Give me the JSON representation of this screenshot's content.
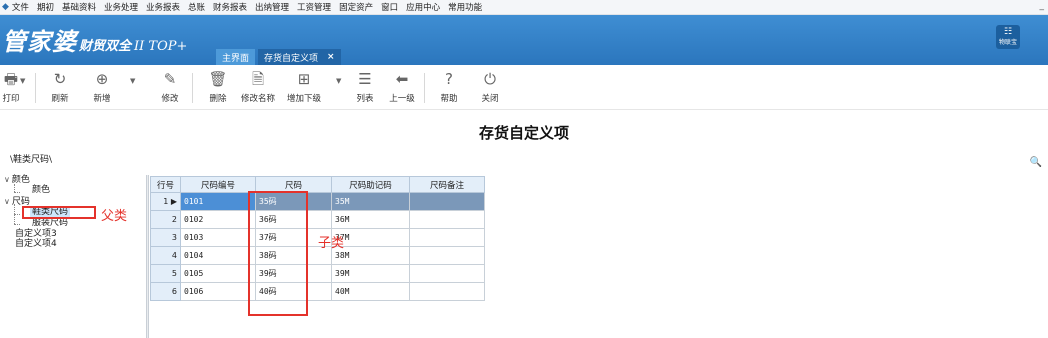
{
  "menu": {
    "items": [
      "文件",
      "期初",
      "基础资料",
      "业务处理",
      "业务报表",
      "总账",
      "财务报表",
      "出纳管理",
      "工资管理",
      "固定资产",
      "窗口",
      "应用中心",
      "常用功能"
    ],
    "window_button": "_"
  },
  "header": {
    "brand_main": "管家婆",
    "brand_sub": "财贸双全",
    "brand_version": "II TOP+",
    "tabs": [
      {
        "label": "主界面"
      },
      {
        "label": "存货自定义项",
        "close": "×"
      }
    ],
    "iot_label": "物联宝"
  },
  "toolbar": [
    {
      "label": "打印",
      "icon": "printer-icon"
    },
    {
      "label": "刷新",
      "icon": "refresh-icon"
    },
    {
      "label": "新增",
      "icon": "add-icon"
    },
    {
      "label": "修改",
      "icon": "edit-icon"
    },
    {
      "label": "删除",
      "icon": "trash-icon"
    },
    {
      "label": "修改名称",
      "icon": "rename-icon"
    },
    {
      "label": "增加下级",
      "icon": "add-child-icon"
    },
    {
      "label": "列表",
      "icon": "list-icon"
    },
    {
      "label": "上一级",
      "icon": "back-arrow-icon"
    },
    {
      "label": "帮助",
      "icon": "help-icon"
    },
    {
      "label": "关闭",
      "icon": "power-icon"
    }
  ],
  "page": {
    "title": "存货自定义项",
    "path": "\\鞋类尺码\\"
  },
  "tree": [
    {
      "label": "颜色",
      "expanded": true
    },
    {
      "label": "颜色"
    },
    {
      "label": "尺码",
      "expanded": true
    },
    {
      "label": "鞋类尺码",
      "selected": true
    },
    {
      "label": "服装尺码"
    },
    {
      "label": "自定义项3"
    },
    {
      "label": "自定义项4"
    }
  ],
  "grid": {
    "headers": [
      "行号",
      "尺码编号",
      "尺码",
      "尺码助记码",
      "尺码备注"
    ],
    "rows": [
      {
        "num": "1",
        "code": "0101",
        "size": "35码",
        "mnemonic": "35M",
        "note": ""
      },
      {
        "num": "2",
        "code": "0102",
        "size": "36码",
        "mnemonic": "36M",
        "note": ""
      },
      {
        "num": "3",
        "code": "0103",
        "size": "37码",
        "mnemonic": "37M",
        "note": ""
      },
      {
        "num": "4",
        "code": "0104",
        "size": "38码",
        "mnemonic": "38M",
        "note": ""
      },
      {
        "num": "5",
        "code": "0105",
        "size": "39码",
        "mnemonic": "39M",
        "note": ""
      },
      {
        "num": "6",
        "code": "0106",
        "size": "40码",
        "mnemonic": "40M",
        "note": ""
      }
    ]
  },
  "annotations": {
    "parent": "父类",
    "child": "子类",
    "color": "#e4322b"
  }
}
